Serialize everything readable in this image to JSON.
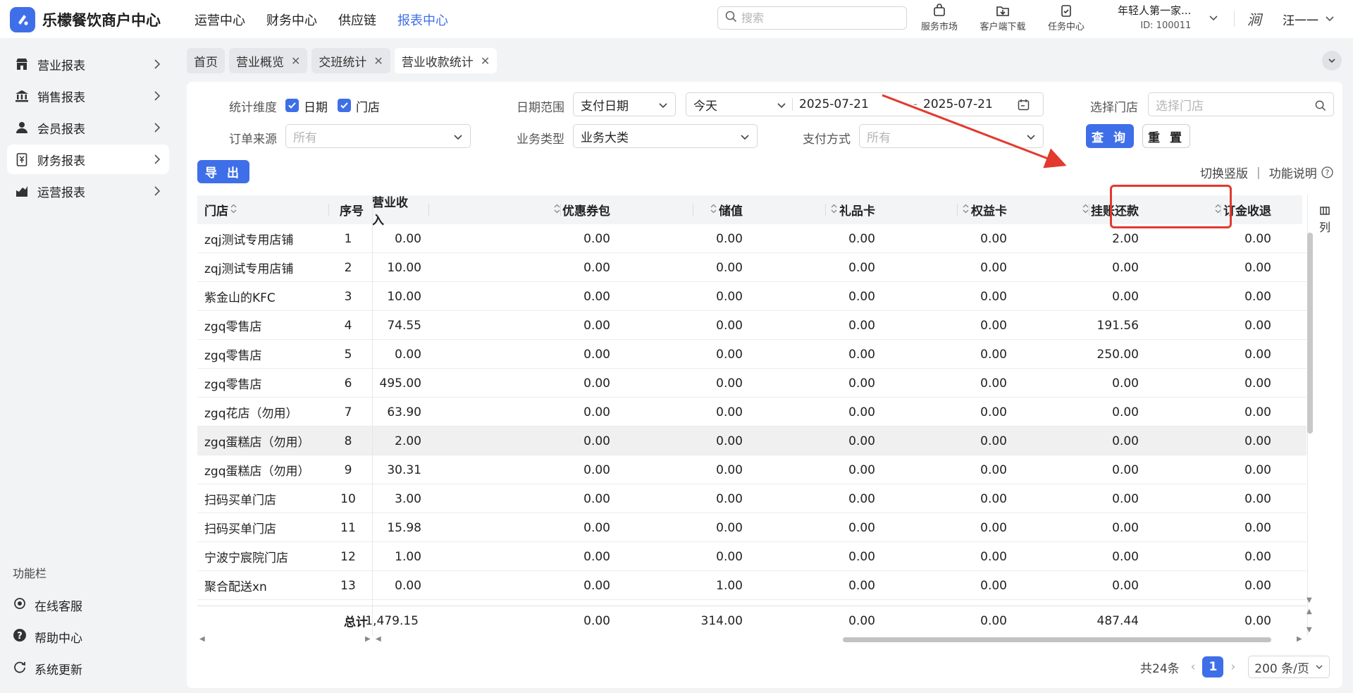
{
  "app": {
    "title": "乐檬餐饮商户中心",
    "brand_color": "#3f6fe8"
  },
  "topnav": [
    {
      "label": "运营中心",
      "active": false
    },
    {
      "label": "财务中心",
      "active": false
    },
    {
      "label": "供应链",
      "active": false
    },
    {
      "label": "报表中心",
      "active": true
    }
  ],
  "search": {
    "placeholder": "搜索"
  },
  "tools": {
    "market": "服务市场",
    "download": "客户端下载",
    "tasks": "任务中心"
  },
  "account": {
    "name": "年轻人第一家...",
    "id": "ID: 100011",
    "user": "汪一一",
    "avatar": "涧"
  },
  "sidebar": {
    "items": [
      {
        "label": "营业报表",
        "icon": "store-icon"
      },
      {
        "label": "销售报表",
        "icon": "bank-icon"
      },
      {
        "label": "会员报表",
        "icon": "user-icon"
      },
      {
        "label": "财务报表",
        "icon": "receipt-icon",
        "active": true
      },
      {
        "label": "运营报表",
        "icon": "chart-icon"
      }
    ],
    "func_title": "功能栏",
    "func_items": [
      {
        "label": "在线客服",
        "icon": "headset-icon"
      },
      {
        "label": "帮助中心",
        "icon": "help-icon"
      },
      {
        "label": "系统更新",
        "icon": "refresh-icon"
      }
    ]
  },
  "tabs": [
    {
      "label": "首页",
      "closable": false
    },
    {
      "label": "营业概览",
      "closable": true
    },
    {
      "label": "交班统计",
      "closable": true
    },
    {
      "label": "营业收款统计",
      "closable": true,
      "active": true
    }
  ],
  "filters": {
    "dimension_label": "统计维度",
    "cb_date": "日期",
    "cb_store": "门店",
    "date_range_label": "日期范围",
    "date_type": "支付日期",
    "preset": "今天",
    "date_start": "2025-07-21",
    "date_end": "2025-07-21",
    "date_sep": "-",
    "store_label": "选择门店",
    "store_placeholder": "选择门店",
    "source_label": "订单来源",
    "source_placeholder": "所有",
    "biz_type_label": "业务类型",
    "biz_type": "业务大类",
    "pay_label": "支付方式",
    "pay_placeholder": "所有",
    "query": "查 询",
    "reset": "重 置",
    "export": "导 出"
  },
  "links": {
    "switch": "切换竖版",
    "sep": "|",
    "help": "功能说明"
  },
  "table": {
    "headers": [
      "门店",
      "序号",
      "营业收入",
      "优惠券包",
      "储值",
      "礼品卡",
      "权益卡",
      "挂账还款",
      "订金收退"
    ],
    "side_col": "列",
    "rows": [
      [
        "zqj测试专用店铺",
        "1",
        "0.00",
        "0.00",
        "0.00",
        "0.00",
        "0.00",
        "2.00",
        "0.00"
      ],
      [
        "zqj测试专用店铺",
        "2",
        "10.00",
        "0.00",
        "0.00",
        "0.00",
        "0.00",
        "0.00",
        "0.00"
      ],
      [
        "紫金山的KFC",
        "3",
        "10.00",
        "0.00",
        "0.00",
        "0.00",
        "0.00",
        "0.00",
        "0.00"
      ],
      [
        "zgq零售店",
        "4",
        "74.55",
        "0.00",
        "0.00",
        "0.00",
        "0.00",
        "191.56",
        "0.00"
      ],
      [
        "zgq零售店",
        "5",
        "0.00",
        "0.00",
        "0.00",
        "0.00",
        "0.00",
        "250.00",
        "0.00"
      ],
      [
        "zgq零售店",
        "6",
        "495.00",
        "0.00",
        "0.00",
        "0.00",
        "0.00",
        "0.00",
        "0.00"
      ],
      [
        "zgq花店（勿用）",
        "7",
        "63.90",
        "0.00",
        "0.00",
        "0.00",
        "0.00",
        "0.00",
        "0.00"
      ],
      [
        "zgq蛋糕店（勿用）",
        "8",
        "2.00",
        "0.00",
        "0.00",
        "0.00",
        "0.00",
        "0.00",
        "0.00"
      ],
      [
        "zgq蛋糕店（勿用）",
        "9",
        "30.31",
        "0.00",
        "0.00",
        "0.00",
        "0.00",
        "0.00",
        "0.00"
      ],
      [
        "扫码买单门店",
        "10",
        "3.00",
        "0.00",
        "0.00",
        "0.00",
        "0.00",
        "0.00",
        "0.00"
      ],
      [
        "扫码买单门店",
        "11",
        "15.98",
        "0.00",
        "0.00",
        "0.00",
        "0.00",
        "0.00",
        "0.00"
      ],
      [
        "宁波宁宸院门店",
        "12",
        "1.00",
        "0.00",
        "0.00",
        "0.00",
        "0.00",
        "0.00",
        "0.00"
      ],
      [
        "聚合配送xn",
        "13",
        "0.00",
        "0.00",
        "1.00",
        "0.00",
        "0.00",
        "0.00",
        "0.00"
      ]
    ],
    "total": [
      "总计",
      "1,479.15",
      "0.00",
      "314.00",
      "0.00",
      "0.00",
      "487.44",
      "0.00"
    ]
  },
  "pager": {
    "total": "共24条",
    "current": "1",
    "size": "200 条/页"
  },
  "annotation_color": "#e23a2e"
}
